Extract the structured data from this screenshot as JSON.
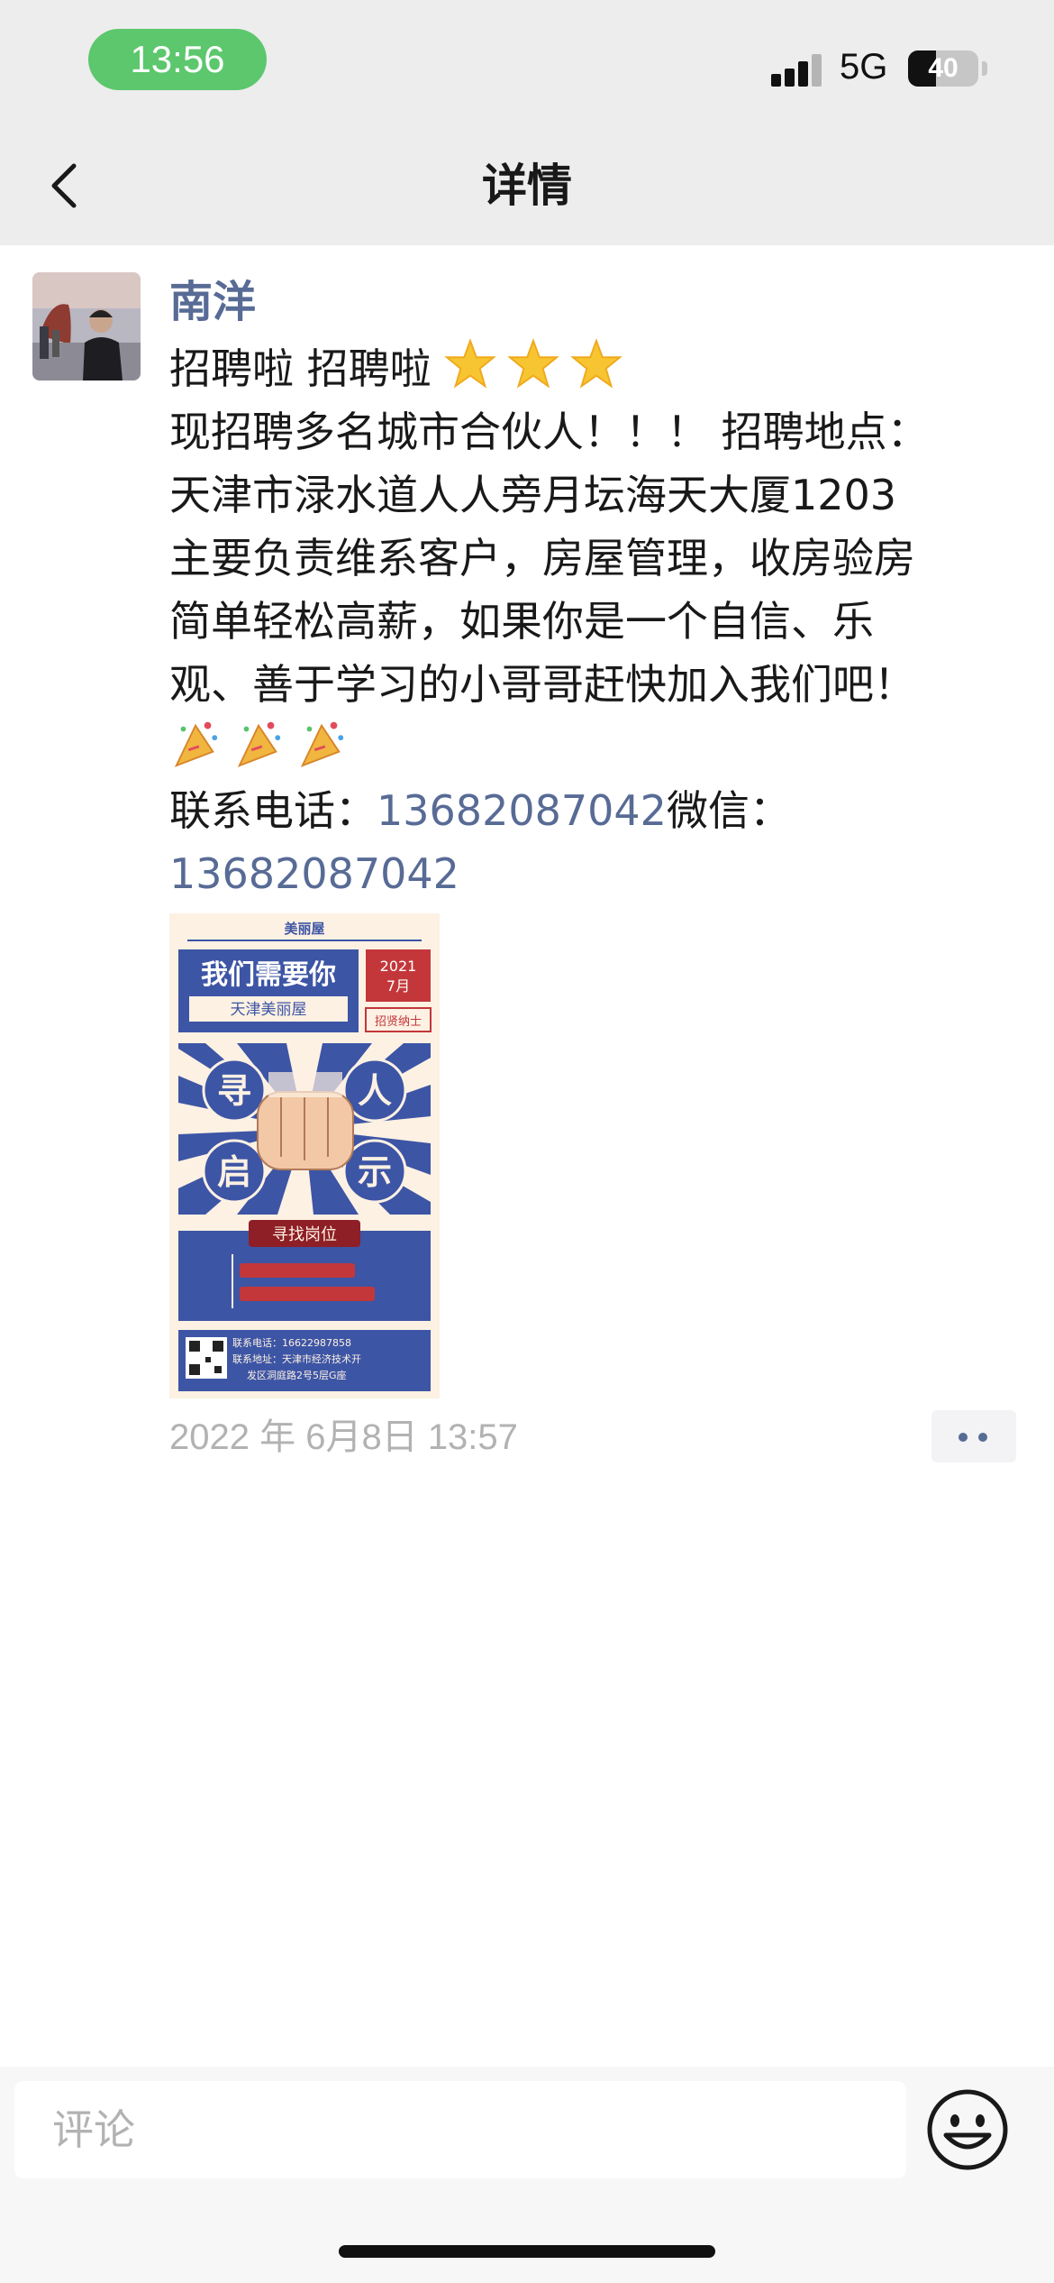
{
  "status_bar": {
    "time": "13:56",
    "network": "5G",
    "battery": "40",
    "battery_level": 0.4,
    "signal_bars": 3
  },
  "nav": {
    "title": "详情",
    "back_icon": "chevron-left-icon"
  },
  "post": {
    "author": "南洋",
    "lines": [
      "招聘啦 招聘啦",
      " 现招聘多名城市合伙人！！！ 招聘地点：",
      "天津市渌水道人人旁月坛海天大厦1203",
      " 主要负责维系客户，房屋管理，收房验房",
      " 简单轻松高薪，如果你是一个自信、乐",
      "观、善于学习的小哥哥赶快加入我们吧！"
    ],
    "contact_label": "联系电话：",
    "phone": "13682087042",
    "wechat_label": "微信：",
    "wechat": "13682087042",
    "time": "2022 年 6月8日 13:57",
    "emojis": {
      "star": "star-icon",
      "party": "party-popper-icon"
    }
  },
  "poster": {
    "brand": "美丽屋",
    "headline": "我们需要你",
    "sub": "天津美丽屋",
    "year": "2021",
    "month": "7月",
    "tag": "招贤纳士",
    "chars": [
      "寻",
      "人",
      "启",
      "示"
    ],
    "position_label": "寻找岗位",
    "phone_line": "联系电话：16622987858",
    "addr_line1": "联系地址：天津市经济技术开",
    "addr_line2": "发区洞庭路2号5层G座",
    "colors": {
      "blue": "#3d55a5",
      "red": "#c3373b",
      "cream": "#fdf1e3"
    }
  },
  "comment_bar": {
    "placeholder": "评论",
    "emoji_icon": "smiley-icon"
  }
}
